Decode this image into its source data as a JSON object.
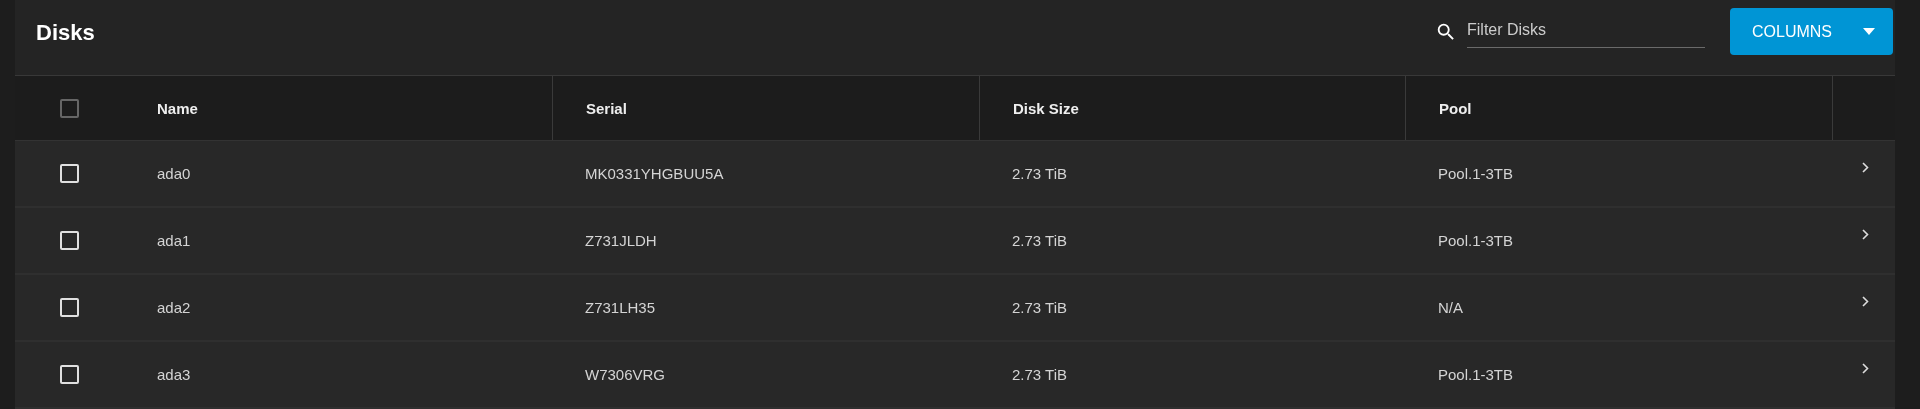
{
  "title": "Disks",
  "filter": {
    "placeholder": "Filter Disks"
  },
  "columns_button": {
    "label": "COLUMNS"
  },
  "table": {
    "select_all": {
      "checked": false,
      "disabled": true
    },
    "columns": [
      "Name",
      "Serial",
      "Disk Size",
      "Pool"
    ],
    "rows": [
      {
        "checked": false,
        "cells": [
          "ada0",
          "MK0331YHGBUU5A",
          "2.73 TiB",
          "Pool.1-3TB"
        ]
      },
      {
        "checked": false,
        "cells": [
          "ada1",
          "Z731JLDH",
          "2.73 TiB",
          "Pool.1-3TB"
        ]
      },
      {
        "checked": false,
        "cells": [
          "ada2",
          "Z731LH35",
          "2.73 TiB",
          "N/A"
        ]
      },
      {
        "checked": false,
        "cells": [
          "ada3",
          "W7306VRG",
          "2.73 TiB",
          "Pool.1-3TB"
        ]
      }
    ]
  }
}
